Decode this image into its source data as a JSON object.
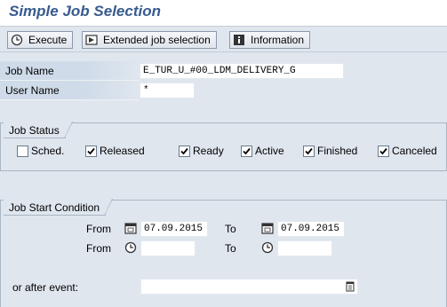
{
  "window": {
    "title": "Simple Job Selection"
  },
  "toolbar": {
    "execute_label": "Execute",
    "extended_label": "Extended job selection",
    "information_label": "Information"
  },
  "fields": {
    "job_name": {
      "label": "Job Name",
      "value": "E_TUR_U_#00_LDM_DELIVERY_G"
    },
    "user_name": {
      "label": "User Name",
      "value": "*"
    }
  },
  "job_status": {
    "title": "Job Status",
    "items": [
      {
        "label": "Sched.",
        "checked": false
      },
      {
        "label": "Released",
        "checked": true
      },
      {
        "label": "Ready",
        "checked": true
      },
      {
        "label": "Active",
        "checked": true
      },
      {
        "label": "Finished",
        "checked": true
      },
      {
        "label": "Canceled",
        "checked": true
      }
    ]
  },
  "job_start": {
    "title": "Job Start Condition",
    "from_label": "From",
    "to_label": "To",
    "date_from": "07.09.2015",
    "date_to": "07.09.2015",
    "time_from": "",
    "time_to": "",
    "event_label": "or after event:",
    "event_value": ""
  },
  "icons": {
    "execute": "execute-clock-icon",
    "extended": "extended-selection-icon",
    "information": "information-icon",
    "calendar": "calendar-icon",
    "clock": "clock-icon",
    "search_help": "search-help-icon"
  }
}
